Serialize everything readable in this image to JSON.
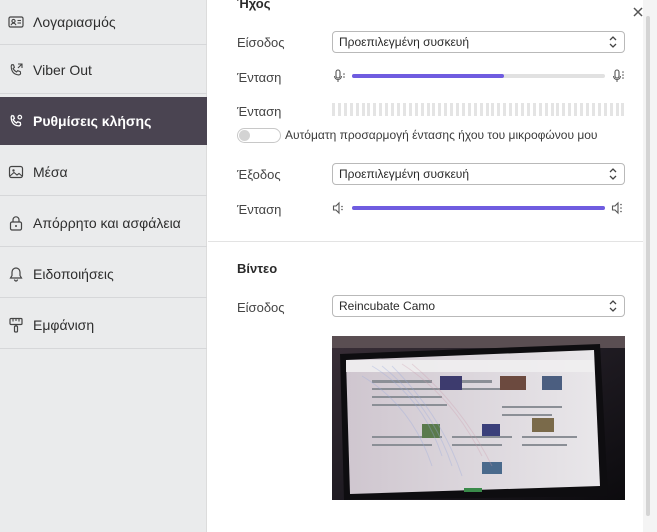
{
  "sidebar": {
    "items": [
      {
        "label": "Λογαριασμός",
        "icon": "account-card-icon",
        "active": false
      },
      {
        "label": "Viber Out",
        "icon": "phone-out-icon",
        "active": false
      },
      {
        "label": "Ρυθμίσεις κλήσης",
        "icon": "call-settings-icon",
        "active": true
      },
      {
        "label": "Μέσα",
        "icon": "media-icon",
        "active": false
      },
      {
        "label": "Απόρρητο και ασφάλεια",
        "icon": "lock-icon",
        "active": false
      },
      {
        "label": "Ειδοποιήσεις",
        "icon": "bell-icon",
        "active": false
      },
      {
        "label": "Εμφάνιση",
        "icon": "brush-icon",
        "active": false
      }
    ]
  },
  "audio": {
    "title": "Ήχος",
    "input_label": "Είσοδος",
    "input_value": "Προεπιλεγμένη συσκευή",
    "input_volume_label": "Ένταση",
    "input_volume_percent": 60,
    "meter_label": "Ένταση",
    "auto_adjust_label": "Αυτόματη προσαρμογή έντασης ήχου του μικροφώνου μου",
    "auto_adjust_on": false,
    "output_label": "Έξοδος",
    "output_value": "Προεπιλεγμένη συσκευή",
    "output_volume_label": "Ένταση",
    "output_volume_percent": 100
  },
  "video": {
    "title": "Βίντεο",
    "input_label": "Είσοδος",
    "input_value": "Reincubate Camo"
  },
  "colors": {
    "accent": "#6f5ce0",
    "sidebar_active": "#4a4451",
    "sidebar_bg": "#eaebec"
  }
}
